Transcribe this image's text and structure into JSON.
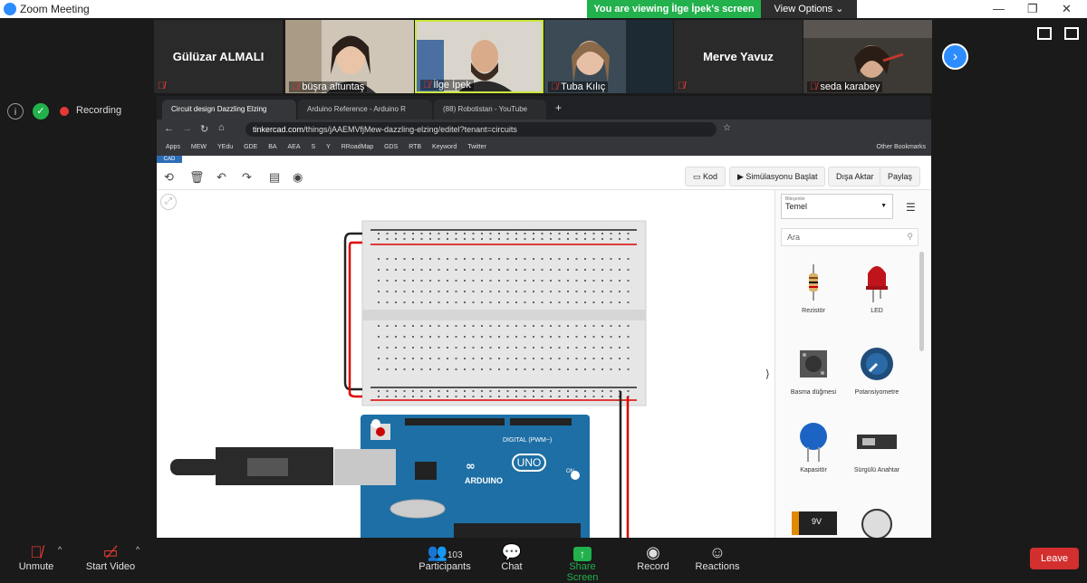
{
  "app": {
    "title": "Zoom Meeting"
  },
  "share_banner": {
    "text": "You are viewing İlge İpek's screen",
    "view_options": "View Options ⌄"
  },
  "participants": [
    {
      "name": "Gülüzar ALMALI",
      "video": false
    },
    {
      "name": "büşra altuntaş",
      "video": true
    },
    {
      "name": "İlge İpek",
      "video": true
    },
    {
      "name": "Tuba Kılıç",
      "video": true
    },
    {
      "name": "Merve Yavuz",
      "video": false
    },
    {
      "name": "seda karabey",
      "video": true
    }
  ],
  "recording": {
    "label": "Recording"
  },
  "browser": {
    "tabs": [
      {
        "label": "Circuit design Dazzling Elzing"
      },
      {
        "label": "Arduino Reference - Arduino R"
      },
      {
        "label": "(88) Robotistan - YouTube"
      }
    ],
    "url_domain": "tinkercad.com",
    "url_path": "/things/jAAEMVfjMew-dazzling-elzing/editel?tenant=circuits",
    "bookmarks": [
      "Apps",
      "MEW",
      "YEdu",
      "GDE",
      "BA",
      "AEA",
      "S",
      "Y",
      "RRoadMap",
      "GDS",
      "RTB",
      "Keyword",
      "Twitter",
      "Other Bookmarks"
    ]
  },
  "tinkercad": {
    "logo": "CAD",
    "toolbar": {
      "code": "Kod",
      "start_sim": "Simülasyonu Başlat",
      "export": "Dışa Aktar",
      "share": "Paylaş"
    },
    "panel": {
      "category_label": "Bileşenler",
      "category": "Temel",
      "search_placeholder": "Ara",
      "components": [
        "Rezistör",
        "LED",
        "Basma düğmesi",
        "Potansiyometre",
        "Kapasitör",
        "Sürgülü Anahtar"
      ]
    },
    "arduino": {
      "brand": "ARDUINO",
      "model": "UNO",
      "digital": "DIGITAL (PWM~)",
      "on": "ON"
    },
    "battery_label": "9V"
  },
  "controls": {
    "unmute": "Unmute",
    "start_video": "Start Video",
    "participants": "Participants",
    "participant_count": "103",
    "chat": "Chat",
    "share_screen": "Share Screen",
    "record": "Record",
    "reactions": "Reactions",
    "leave": "Leave"
  },
  "colors": {
    "zoom_blue": "#2d8cff",
    "share_green": "#22b14c",
    "leave_red": "#d32f2f",
    "arduino_blue": "#1d6fa5"
  }
}
